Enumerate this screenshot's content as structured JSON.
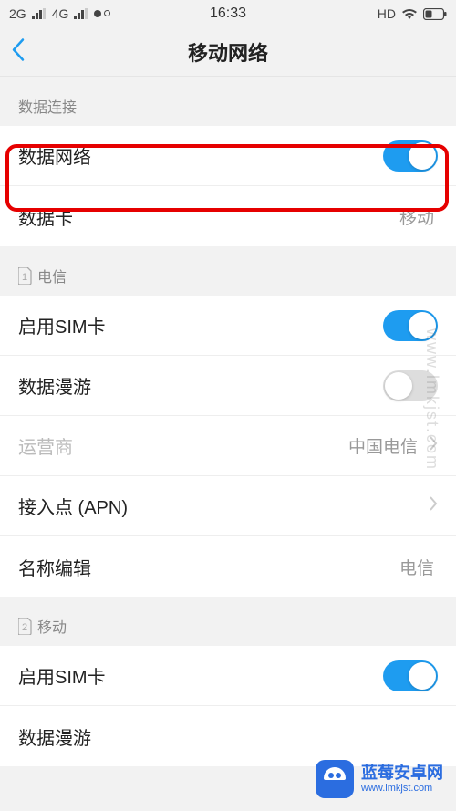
{
  "status": {
    "net1": "2G",
    "net2": "4G",
    "time": "16:33",
    "hd": "HD"
  },
  "nav": {
    "title": "移动网络"
  },
  "sections": {
    "data_conn": {
      "header": "数据连接"
    },
    "telecom": {
      "header": "电信",
      "sim_index": "1"
    },
    "mobile": {
      "header": "移动",
      "sim_index": "2"
    }
  },
  "rows": {
    "data_network": {
      "label": "数据网络"
    },
    "data_card": {
      "label": "数据卡",
      "value": "移动"
    },
    "enable_sim_1": {
      "label": "启用SIM卡"
    },
    "data_roaming_1": {
      "label": "数据漫游"
    },
    "carrier": {
      "label": "运营商",
      "value": "中国电信"
    },
    "apn": {
      "label": "接入点 (APN)"
    },
    "name_edit": {
      "label": "名称编辑",
      "value": "电信"
    },
    "enable_sim_2": {
      "label": "启用SIM卡"
    },
    "data_roaming_2": {
      "label": "数据漫游"
    }
  },
  "watermark": {
    "text": "www.lmkjst.com"
  },
  "footer": {
    "cn": "蓝莓安卓网",
    "url": "www.lmkjst.com"
  }
}
